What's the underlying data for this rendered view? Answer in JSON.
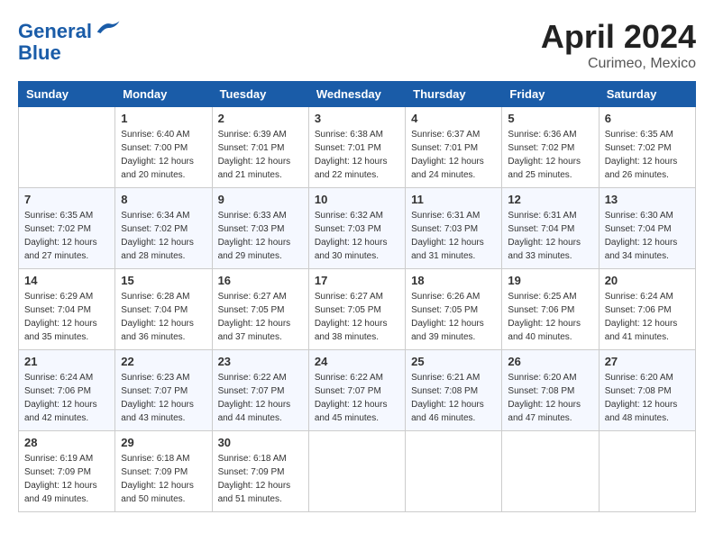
{
  "header": {
    "logo_line1": "General",
    "logo_line2": "Blue",
    "title": "April 2024",
    "location": "Curimeo, Mexico"
  },
  "days_of_week": [
    "Sunday",
    "Monday",
    "Tuesday",
    "Wednesday",
    "Thursday",
    "Friday",
    "Saturday"
  ],
  "weeks": [
    [
      {
        "day": "",
        "sunrise": "",
        "sunset": "",
        "daylight": ""
      },
      {
        "day": "1",
        "sunrise": "6:40 AM",
        "sunset": "7:00 PM",
        "daylight": "12 hours and 20 minutes."
      },
      {
        "day": "2",
        "sunrise": "6:39 AM",
        "sunset": "7:01 PM",
        "daylight": "12 hours and 21 minutes."
      },
      {
        "day": "3",
        "sunrise": "6:38 AM",
        "sunset": "7:01 PM",
        "daylight": "12 hours and 22 minutes."
      },
      {
        "day": "4",
        "sunrise": "6:37 AM",
        "sunset": "7:01 PM",
        "daylight": "12 hours and 24 minutes."
      },
      {
        "day": "5",
        "sunrise": "6:36 AM",
        "sunset": "7:02 PM",
        "daylight": "12 hours and 25 minutes."
      },
      {
        "day": "6",
        "sunrise": "6:35 AM",
        "sunset": "7:02 PM",
        "daylight": "12 hours and 26 minutes."
      }
    ],
    [
      {
        "day": "7",
        "sunrise": "6:35 AM",
        "sunset": "7:02 PM",
        "daylight": "12 hours and 27 minutes."
      },
      {
        "day": "8",
        "sunrise": "6:34 AM",
        "sunset": "7:02 PM",
        "daylight": "12 hours and 28 minutes."
      },
      {
        "day": "9",
        "sunrise": "6:33 AM",
        "sunset": "7:03 PM",
        "daylight": "12 hours and 29 minutes."
      },
      {
        "day": "10",
        "sunrise": "6:32 AM",
        "sunset": "7:03 PM",
        "daylight": "12 hours and 30 minutes."
      },
      {
        "day": "11",
        "sunrise": "6:31 AM",
        "sunset": "7:03 PM",
        "daylight": "12 hours and 31 minutes."
      },
      {
        "day": "12",
        "sunrise": "6:31 AM",
        "sunset": "7:04 PM",
        "daylight": "12 hours and 33 minutes."
      },
      {
        "day": "13",
        "sunrise": "6:30 AM",
        "sunset": "7:04 PM",
        "daylight": "12 hours and 34 minutes."
      }
    ],
    [
      {
        "day": "14",
        "sunrise": "6:29 AM",
        "sunset": "7:04 PM",
        "daylight": "12 hours and 35 minutes."
      },
      {
        "day": "15",
        "sunrise": "6:28 AM",
        "sunset": "7:04 PM",
        "daylight": "12 hours and 36 minutes."
      },
      {
        "day": "16",
        "sunrise": "6:27 AM",
        "sunset": "7:05 PM",
        "daylight": "12 hours and 37 minutes."
      },
      {
        "day": "17",
        "sunrise": "6:27 AM",
        "sunset": "7:05 PM",
        "daylight": "12 hours and 38 minutes."
      },
      {
        "day": "18",
        "sunrise": "6:26 AM",
        "sunset": "7:05 PM",
        "daylight": "12 hours and 39 minutes."
      },
      {
        "day": "19",
        "sunrise": "6:25 AM",
        "sunset": "7:06 PM",
        "daylight": "12 hours and 40 minutes."
      },
      {
        "day": "20",
        "sunrise": "6:24 AM",
        "sunset": "7:06 PM",
        "daylight": "12 hours and 41 minutes."
      }
    ],
    [
      {
        "day": "21",
        "sunrise": "6:24 AM",
        "sunset": "7:06 PM",
        "daylight": "12 hours and 42 minutes."
      },
      {
        "day": "22",
        "sunrise": "6:23 AM",
        "sunset": "7:07 PM",
        "daylight": "12 hours and 43 minutes."
      },
      {
        "day": "23",
        "sunrise": "6:22 AM",
        "sunset": "7:07 PM",
        "daylight": "12 hours and 44 minutes."
      },
      {
        "day": "24",
        "sunrise": "6:22 AM",
        "sunset": "7:07 PM",
        "daylight": "12 hours and 45 minutes."
      },
      {
        "day": "25",
        "sunrise": "6:21 AM",
        "sunset": "7:08 PM",
        "daylight": "12 hours and 46 minutes."
      },
      {
        "day": "26",
        "sunrise": "6:20 AM",
        "sunset": "7:08 PM",
        "daylight": "12 hours and 47 minutes."
      },
      {
        "day": "27",
        "sunrise": "6:20 AM",
        "sunset": "7:08 PM",
        "daylight": "12 hours and 48 minutes."
      }
    ],
    [
      {
        "day": "28",
        "sunrise": "6:19 AM",
        "sunset": "7:09 PM",
        "daylight": "12 hours and 49 minutes."
      },
      {
        "day": "29",
        "sunrise": "6:18 AM",
        "sunset": "7:09 PM",
        "daylight": "12 hours and 50 minutes."
      },
      {
        "day": "30",
        "sunrise": "6:18 AM",
        "sunset": "7:09 PM",
        "daylight": "12 hours and 51 minutes."
      },
      {
        "day": "",
        "sunrise": "",
        "sunset": "",
        "daylight": ""
      },
      {
        "day": "",
        "sunrise": "",
        "sunset": "",
        "daylight": ""
      },
      {
        "day": "",
        "sunrise": "",
        "sunset": "",
        "daylight": ""
      },
      {
        "day": "",
        "sunrise": "",
        "sunset": "",
        "daylight": ""
      }
    ]
  ],
  "labels": {
    "sunrise_prefix": "Sunrise: ",
    "sunset_prefix": "Sunset: ",
    "daylight_prefix": "Daylight: "
  }
}
